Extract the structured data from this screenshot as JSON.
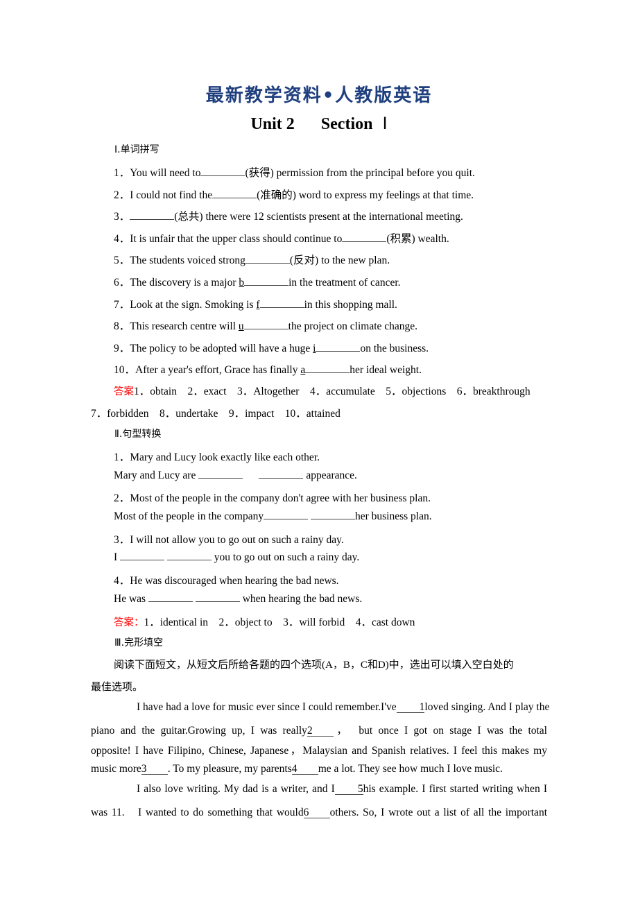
{
  "header": {
    "title": "最新教学资料•人教版英语",
    "unit": "Unit 2",
    "section": "Section",
    "section_numeral": "Ⅰ"
  },
  "section1": {
    "heading": "Ⅰ.单词拼写",
    "items": [
      {
        "num": "1．",
        "before": "You will need to",
        "hint_letter": "",
        "after": "(获得) permission from the principal before you quit."
      },
      {
        "num": "2．",
        "before": "I could not find the",
        "hint_letter": "",
        "after": "(准确的) word to express my feelings at that time."
      },
      {
        "num": "3．",
        "before": "",
        "hint_letter": "",
        "after": "(总共) there were 12 scientists present at the international meeting."
      },
      {
        "num": "4．",
        "before": "It is unfair that the upper class should continue to",
        "hint_letter": "",
        "after": "(积累) wealth."
      },
      {
        "num": "5．",
        "before": "The students voiced strong",
        "hint_letter": "",
        "after": "(反对) to the new plan."
      },
      {
        "num": "6．",
        "before": "The discovery is a major ",
        "hint_letter": "b",
        "after": "in the treatment of cancer."
      },
      {
        "num": "7．",
        "before": "Look at the sign. Smoking is ",
        "hint_letter": "f",
        "after": "in this shopping mall."
      },
      {
        "num": "8．",
        "before": "This research centre will ",
        "hint_letter": "u",
        "after": "the project on climate change."
      },
      {
        "num": "9．",
        "before": "The policy to be adopted will have a huge ",
        "hint_letter": "i",
        "after": "on the business."
      },
      {
        "num": "10．",
        "before": "After a year's effort, Grace has finally ",
        "hint_letter": "a",
        "after": "her ideal weight."
      }
    ],
    "answer_label": "答案",
    "answer_line1": "1．obtain　2．exact　3．Altogether　4．accumulate　5．objections　6．breakthrough",
    "answer_line2": "7．forbidden　8．undertake　9．impact　10．attained"
  },
  "section2": {
    "heading": "Ⅱ.句型转换",
    "items": [
      {
        "num": "1．",
        "original": "Mary and Lucy look exactly like each other.",
        "rewrite_before": "Mary and Lucy are ",
        "rewrite_after": " appearance."
      },
      {
        "num": "2．",
        "original": "Most of the people in the company don't agree with her business plan.",
        "rewrite_before": "Most of the people in the company",
        "rewrite_after": "her business plan."
      },
      {
        "num": "3．",
        "original": "I will not allow you to go out on such a rainy day.",
        "rewrite_before": "I ",
        "rewrite_after": " you to go out on such a rainy day."
      },
      {
        "num": "4．",
        "original": "He was discouraged when hearing the bad news.",
        "rewrite_before": "He was ",
        "rewrite_after": " when hearing the bad news."
      }
    ],
    "answer_label": "答案：",
    "answer_text": "1．identical in　2．object to　3．will forbid　4．cast down"
  },
  "section3": {
    "heading": "Ⅲ.完形填空",
    "instructions_line1": "阅读下面短文，从短文后所给各题的四个选项(A，B，C和D)中，选出可以填入空白处的",
    "instructions_line2": "最佳选项。",
    "passage": [
      {
        "parts": [
          "I have had a love for music ever since I could remember.I've",
          "1",
          "loved singing. And I play the"
        ]
      },
      {
        "parts": [
          "piano and the guitar.Growing up, I was really",
          "2",
          "，　but once I got on stage I was the total"
        ]
      },
      {
        "parts": [
          "opposite! I have Filipino, Chinese, Japanese，Malaysian and Spanish relatives. I feel this makes my"
        ]
      },
      {
        "parts": [
          "music more",
          "3",
          ". To my pleasure, my parents",
          "4",
          "me a lot. They see how much I love music."
        ]
      },
      {
        "parts": [
          "I also love writing. My dad is a writer, and I",
          "5",
          "his example. I first started writing when I"
        ]
      },
      {
        "parts": [
          "was 11.　I wanted to do something that would",
          "6",
          "others. So, I wrote out a list of all the important"
        ]
      }
    ]
  },
  "colors": {
    "title": "#1f3f7f",
    "answer_label": "#ff0000",
    "text": "#000000"
  }
}
